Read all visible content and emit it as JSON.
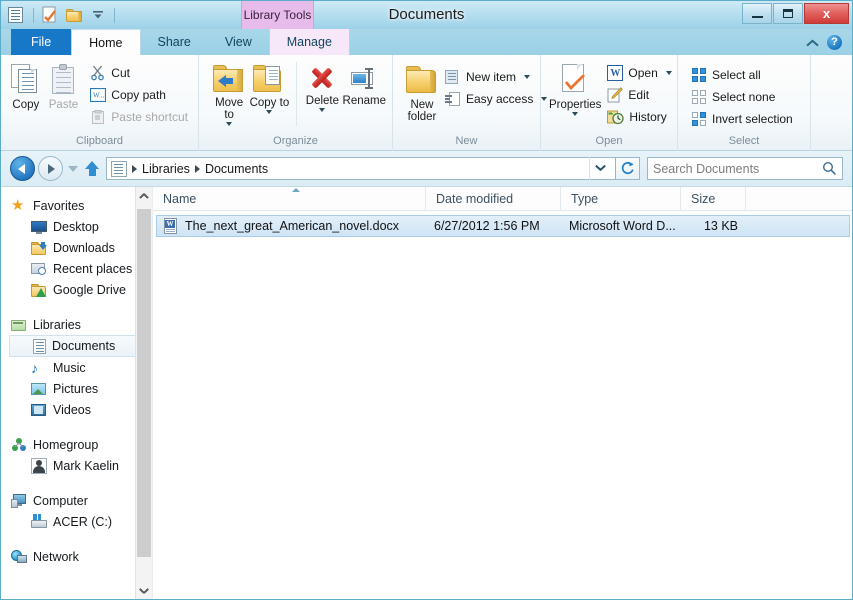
{
  "window": {
    "title": "Documents",
    "contextual_tab_group": "Library Tools",
    "controls": {
      "minimize": "Minimize",
      "maximize": "Maximize",
      "close": "x"
    }
  },
  "quick_access": [
    {
      "name": "properties-icon",
      "tooltip": "Properties"
    },
    {
      "name": "new-folder-icon",
      "tooltip": "New folder"
    },
    {
      "name": "customize-icon",
      "tooltip": "Customize Quick Access Toolbar"
    }
  ],
  "tabs": [
    {
      "id": "file",
      "label": "File"
    },
    {
      "id": "home",
      "label": "Home"
    },
    {
      "id": "share",
      "label": "Share"
    },
    {
      "id": "view",
      "label": "View"
    },
    {
      "id": "manage",
      "label": "Manage"
    }
  ],
  "tab_right": {
    "collapse": "Minimize the Ribbon",
    "help": "?"
  },
  "ribbon": {
    "groups": [
      {
        "label": "Clipboard",
        "big": [
          {
            "label": "Copy",
            "enabled": true
          },
          {
            "label": "Paste",
            "enabled": false
          }
        ],
        "small": [
          {
            "label": "Cut",
            "enabled": true
          },
          {
            "label": "Copy path",
            "enabled": true
          },
          {
            "label": "Paste shortcut",
            "enabled": false
          }
        ]
      },
      {
        "label": "Organize",
        "big": [
          {
            "label": "Move to",
            "enabled": true,
            "split": true
          },
          {
            "label": "Copy to",
            "enabled": true,
            "split": true
          },
          {
            "label": "Delete",
            "enabled": true,
            "split": true
          },
          {
            "label": "Rename",
            "enabled": true
          }
        ]
      },
      {
        "label": "New",
        "big": [
          {
            "label": "New folder",
            "enabled": true
          }
        ],
        "small": [
          {
            "label": "New item",
            "enabled": true,
            "split": true
          },
          {
            "label": "Easy access",
            "enabled": true,
            "split": true
          }
        ]
      },
      {
        "label": "Open",
        "big": [
          {
            "label": "Properties",
            "enabled": true,
            "split": true
          }
        ],
        "small": [
          {
            "label": "Open",
            "enabled": true,
            "split": true
          },
          {
            "label": "Edit",
            "enabled": true
          },
          {
            "label": "History",
            "enabled": true
          }
        ]
      },
      {
        "label": "Select",
        "small": [
          {
            "label": "Select all",
            "enabled": true
          },
          {
            "label": "Select none",
            "enabled": true
          },
          {
            "label": "Invert selection",
            "enabled": true
          }
        ]
      }
    ],
    "labels": {
      "copy": "Copy",
      "paste": "Paste",
      "cut": "Cut",
      "copy_path": "Copy path",
      "paste_shortcut": "Paste shortcut",
      "move_to": "Move to",
      "copy_to": "Copy to",
      "delete": "Delete",
      "rename": "Rename",
      "new_folder": "New folder",
      "new_item": "New item",
      "easy_access": "Easy access",
      "properties": "Properties",
      "open": "Open",
      "edit": "Edit",
      "history": "History",
      "select_all": "Select all",
      "select_none": "Select none",
      "invert_selection": "Invert selection",
      "group_clipboard": "Clipboard",
      "group_organize": "Organize",
      "group_new": "New",
      "group_open": "Open",
      "group_select": "Select"
    }
  },
  "address": {
    "breadcrumb": [
      "Libraries",
      "Documents"
    ],
    "crumb1": "Libraries",
    "crumb2": "Documents",
    "search_placeholder": "Search Documents",
    "refresh_tooltip": "Refresh"
  },
  "navigation": {
    "sections": [
      {
        "header": "Favorites",
        "icon": "star-icon",
        "items": [
          {
            "label": "Desktop",
            "icon": "desktop-icon"
          },
          {
            "label": "Downloads",
            "icon": "downloads-folder-icon"
          },
          {
            "label": "Recent places",
            "icon": "recent-places-icon"
          },
          {
            "label": "Google Drive",
            "icon": "google-drive-icon"
          }
        ]
      },
      {
        "header": "Libraries",
        "icon": "library-icon",
        "items": [
          {
            "label": "Documents",
            "icon": "documents-icon",
            "selected": true
          },
          {
            "label": "Music",
            "icon": "music-icon"
          },
          {
            "label": "Pictures",
            "icon": "pictures-icon"
          },
          {
            "label": "Videos",
            "icon": "videos-icon"
          }
        ]
      },
      {
        "header": "Homegroup",
        "icon": "homegroup-icon",
        "items": [
          {
            "label": "Mark Kaelin",
            "icon": "user-icon"
          }
        ]
      },
      {
        "header": "Computer",
        "icon": "computer-icon",
        "items": [
          {
            "label": "ACER (C:)",
            "icon": "hard-drive-icon"
          }
        ]
      },
      {
        "header": "Network",
        "icon": "network-icon",
        "items": []
      }
    ],
    "flat": {
      "favorites": "Favorites",
      "desktop": "Desktop",
      "downloads": "Downloads",
      "recent_places": "Recent places",
      "google_drive": "Google Drive",
      "libraries": "Libraries",
      "documents": "Documents",
      "music": "Music",
      "pictures": "Pictures",
      "videos": "Videos",
      "homegroup": "Homegroup",
      "mark_kaelin": "Mark Kaelin",
      "computer": "Computer",
      "acer_c": "ACER (C:)",
      "network": "Network"
    }
  },
  "file_list": {
    "columns": [
      {
        "key": "name",
        "label": "Name",
        "sorted": "asc"
      },
      {
        "key": "date",
        "label": "Date modified"
      },
      {
        "key": "type",
        "label": "Type"
      },
      {
        "key": "size",
        "label": "Size"
      }
    ],
    "column_labels": {
      "name": "Name",
      "date": "Date modified",
      "type": "Type",
      "size": "Size"
    },
    "rows": [
      {
        "name": "The_next_great_American_novel.docx",
        "date": "6/27/2012 1:56 PM",
        "type": "Microsoft Word D...",
        "size": "13 KB",
        "icon": "word-document-icon",
        "selected": true
      }
    ],
    "row0": {
      "name": "The_next_great_American_novel.docx",
      "date": "6/27/2012 1:56 PM",
      "type": "Microsoft Word D...",
      "size": "13 KB"
    }
  },
  "colors": {
    "accent_blue": "#1878c8",
    "title_gradient_top": "#cfeaf6",
    "title_gradient_bottom": "#9ed2e8",
    "contextual_pink": "#e8bcea",
    "close_red": "#cf3b38",
    "selection_blue": "#cfe4f5",
    "folder_yellow": "#f6cf6c"
  }
}
